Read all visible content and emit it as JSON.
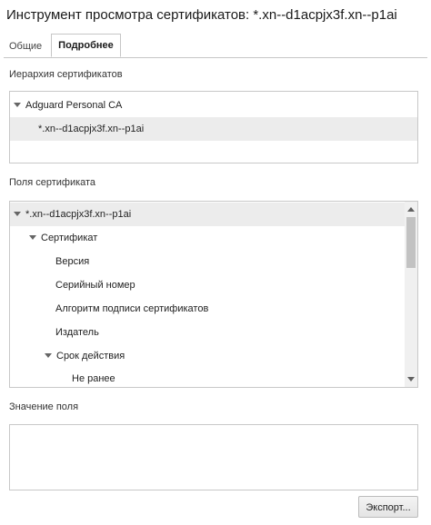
{
  "window": {
    "title": "Инструмент просмотра сертификатов: *.xn--d1acpjx3f.xn--p1ai"
  },
  "tabs": [
    {
      "label": "Общие",
      "active": false
    },
    {
      "label": "Подробнее",
      "active": true
    }
  ],
  "hierarchy": {
    "label": "Иерархия сертификатов",
    "items": [
      {
        "label": "Adguard Personal CA",
        "expanded": true,
        "selected": false
      },
      {
        "label": "*.xn--d1acpjx3f.xn--p1ai",
        "selected": true
      }
    ]
  },
  "fields": {
    "label": "Поля сертификата",
    "items": [
      {
        "label": "*.xn--d1acpjx3f.xn--p1ai",
        "expanded": true,
        "selected": true
      },
      {
        "label": "Сертификат",
        "expanded": true
      },
      {
        "label": "Версия"
      },
      {
        "label": "Серийный номер"
      },
      {
        "label": "Алгоритм подписи сертификатов"
      },
      {
        "label": "Издатель"
      },
      {
        "label": "Срок действия",
        "expanded": true
      },
      {
        "label": "Не ранее"
      }
    ]
  },
  "value": {
    "label": "Значение поля",
    "text": ""
  },
  "buttons": {
    "export_label": "Экспорт..."
  }
}
